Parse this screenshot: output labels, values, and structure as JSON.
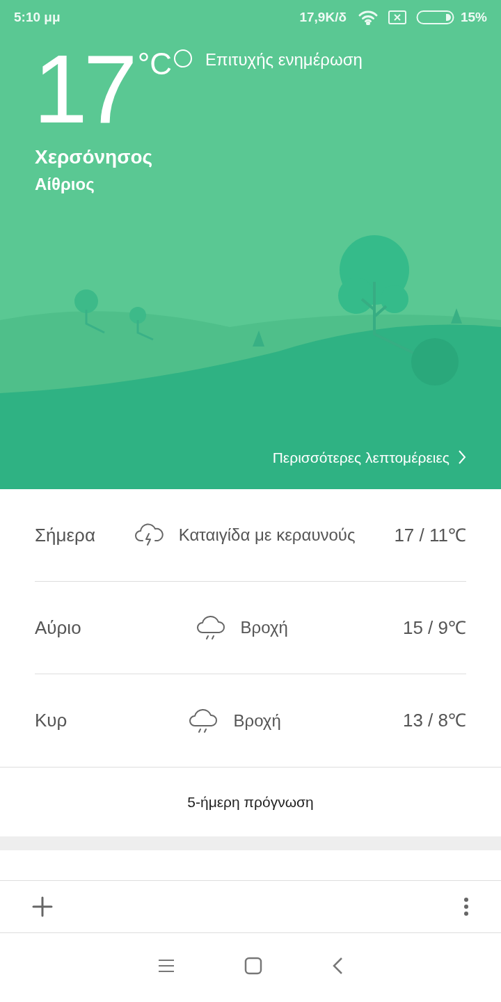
{
  "status_bar": {
    "time": "5:10 μμ",
    "speed": "17,9K/δ",
    "battery": "15%"
  },
  "current": {
    "temperature": "17",
    "unit": "°C",
    "update_status": "Επιτυχής ενημέρωση",
    "location": "Χερσόνησος",
    "condition": "Αίθριος",
    "more_link": "Περισσότερες λεπτομέρειες"
  },
  "forecast": [
    {
      "day": "Σήμερα",
      "kind": "thunderstorm",
      "condition": "Καταιγίδα με κεραυνούς",
      "range": "17 / 11℃"
    },
    {
      "day": "Αύριο",
      "kind": "rain",
      "condition": "Βροχή",
      "range": "15 / 9℃"
    },
    {
      "day": "Κυρ",
      "kind": "rain",
      "condition": "Βροχή",
      "range": "13 / 8℃"
    }
  ],
  "five_day_button": "5-ήμερη πρόγνωση"
}
